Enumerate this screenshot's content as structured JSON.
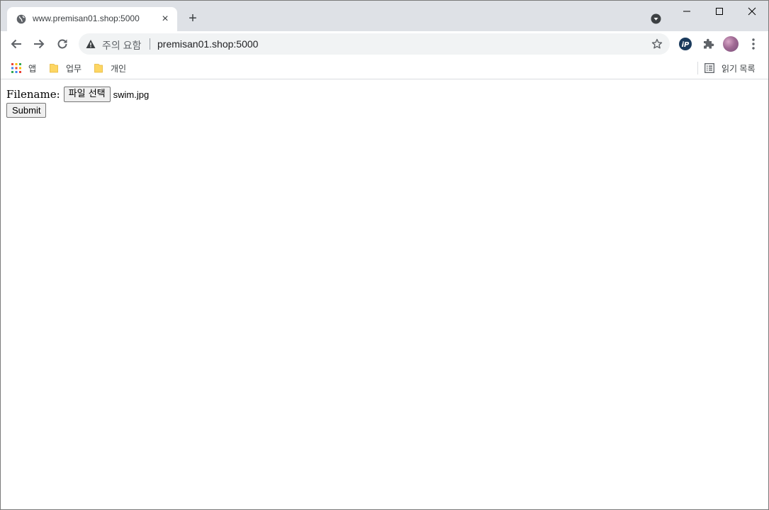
{
  "browser": {
    "tab": {
      "title": "www.premisan01.shop:5000",
      "close": "×",
      "favicon": "globe-icon"
    },
    "new_tab": "+",
    "omnibox": {
      "security_label": "주의 요함",
      "url": "premisan01.shop:5000"
    },
    "bookmarks": [
      {
        "label": "앱",
        "icon": "apps-grid-icon"
      },
      {
        "label": "업무",
        "icon": "folder-icon"
      },
      {
        "label": "개인",
        "icon": "folder-icon"
      }
    ],
    "reading_list": {
      "label": "읽기 목록",
      "icon": "reading-list-icon"
    },
    "colors": {
      "tabstrip": "#dee1e6",
      "omnibox": "#f1f3f4",
      "folder": "#fdd663"
    }
  },
  "page": {
    "form": {
      "label": "Filename:",
      "file_button": "파일 선택",
      "file_name": "swim.jpg",
      "submit_label": "Submit"
    }
  }
}
